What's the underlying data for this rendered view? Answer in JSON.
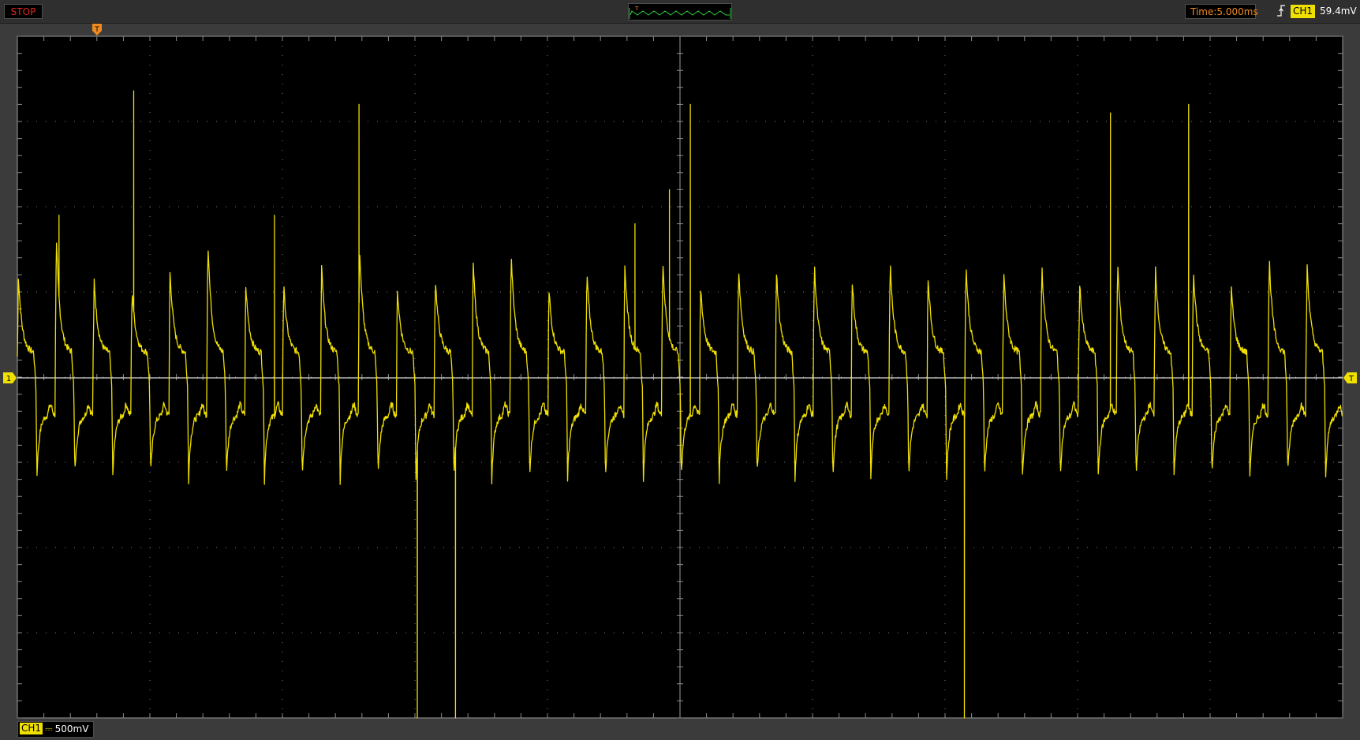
{
  "status": {
    "run_state": "STOP"
  },
  "timebase": {
    "label": "Time:5.000ms"
  },
  "trigger": {
    "channel": "CH1",
    "level": "59.4mV",
    "edge": "rising",
    "marker": "T"
  },
  "channel1": {
    "name": "CH1",
    "marker": "1",
    "coupling_symbol": "⎓",
    "scale": "500mV",
    "color": "#f0e000"
  },
  "colors": {
    "trace": "#f0e000",
    "stop": "#e0281d",
    "time": "#f08a1f",
    "trigger_marker": "#f08a1f",
    "grid": "#7a7a7a",
    "overview": "#2ecc40"
  },
  "chart_data": {
    "type": "line",
    "title": "",
    "xlabel": "",
    "ylabel": "",
    "grid": true,
    "x_divisions": 10,
    "y_divisions": 8,
    "x_unit": "ms",
    "y_unit": "V",
    "time_per_div": 5.0,
    "volts_per_div": 0.5,
    "xlim": [
      0,
      50
    ],
    "ylim": [
      -2.0,
      2.0
    ],
    "series": [
      {
        "channel": "CH1",
        "color": "#f0e000",
        "baseline": 0.0,
        "pulse_period_ms": 1.43,
        "pulse_count": 35,
        "shape": "differentiated square wave: decaying positive peak ~0.45 V, shelf ~0.15 V, sharp negative overshoot ~-0.55 V",
        "spike_high_times_ms": [
          1.57,
          4.39,
          9.7,
          12.89,
          23.3,
          24.6,
          25.39,
          41.24,
          44.19
        ],
        "spike_high_values_v": [
          0.95,
          1.68,
          0.95,
          1.6,
          0.9,
          1.1,
          1.6,
          1.55,
          1.6
        ],
        "spike_low_times_ms": [
          15.09,
          16.53,
          35.73
        ],
        "spike_low_values_v": [
          -2.0,
          -2.0,
          -2.0
        ]
      }
    ]
  }
}
